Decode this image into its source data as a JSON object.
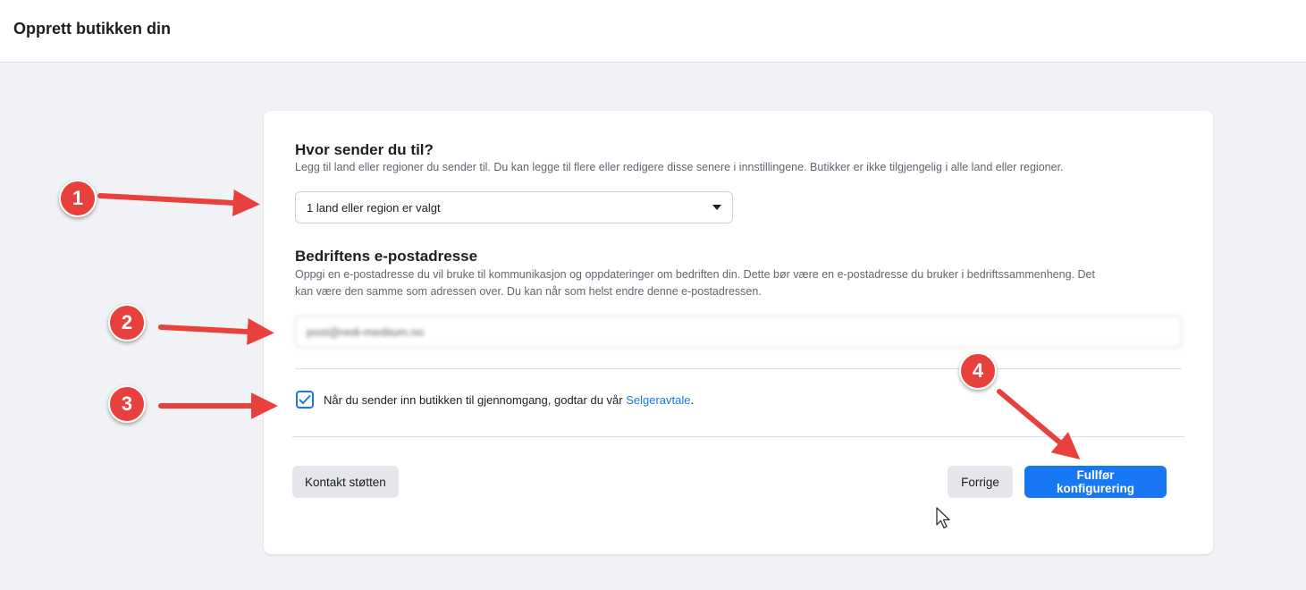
{
  "header": {
    "title": "Opprett butikken din"
  },
  "shipping": {
    "heading": "Hvor sender du til?",
    "description": "Legg til land eller regioner du sender til. Du kan legge til flere eller redigere disse senere i innstillingene. Butikker er ikke tilgjengelig i alle land eller regioner.",
    "selected_value": "1 land eller region er valgt"
  },
  "email": {
    "heading": "Bedriftens e-postadresse",
    "description_line1": "Oppgi en e-postadresse du vil bruke til kommunikasjon og oppdateringer om bedriften din. Dette bør være en e-postadresse du bruker i bedriftssammenheng. Det",
    "description_line2": "kan være den samme som adressen over. Du kan når som helst endre denne e-postadressen.",
    "value": "post@redi-mediium.no"
  },
  "agreement": {
    "checked": true,
    "text": "Når du sender inn butikken til gjennomgang, godtar du vår ",
    "link_label": "Selgeravtale",
    "trailing": "."
  },
  "footer": {
    "support_label": "Kontakt støtten",
    "back_label": "Forrige",
    "finish_label": "Fullfør konfigurering"
  },
  "annotations": {
    "badges": [
      "1",
      "2",
      "3",
      "4"
    ],
    "badge_color": "#e8403c"
  },
  "colors": {
    "accent": "#1877f2",
    "background": "#f0f2f5"
  }
}
